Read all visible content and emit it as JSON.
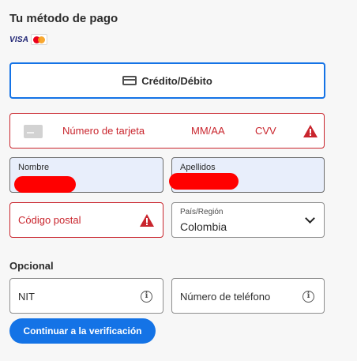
{
  "section_title": "Tu método de pago",
  "card_brands": {
    "visa_label": "VISA",
    "mastercard_icon": "mastercard-logo"
  },
  "payment_tab": {
    "label": "Crédito/Débito",
    "icon": "credit-card-icon"
  },
  "card_fields": {
    "number_placeholder": "Número de tarjeta",
    "expiry_placeholder": "MM/AA",
    "cvv_placeholder": "CVV",
    "error_icon": "warning-icon"
  },
  "name_field": {
    "label": "Nombre"
  },
  "surname_field": {
    "label": "Apellidos"
  },
  "postal_field": {
    "placeholder": "Código postal",
    "error_icon": "warning-icon"
  },
  "country_field": {
    "label": "País/Región",
    "value": "Colombia"
  },
  "optional_section": {
    "title": "Opcional"
  },
  "nit_field": {
    "placeholder": "NIT",
    "icon": "info-icon"
  },
  "phone_field": {
    "placeholder": "Número de teléfono",
    "icon": "info-icon"
  },
  "cta": {
    "label": "Continuar a la verificación"
  },
  "colors": {
    "accent": "#1473e6",
    "error": "#c9252d",
    "filled_bg": "#e8eefb",
    "redaction": "#ff0000"
  }
}
